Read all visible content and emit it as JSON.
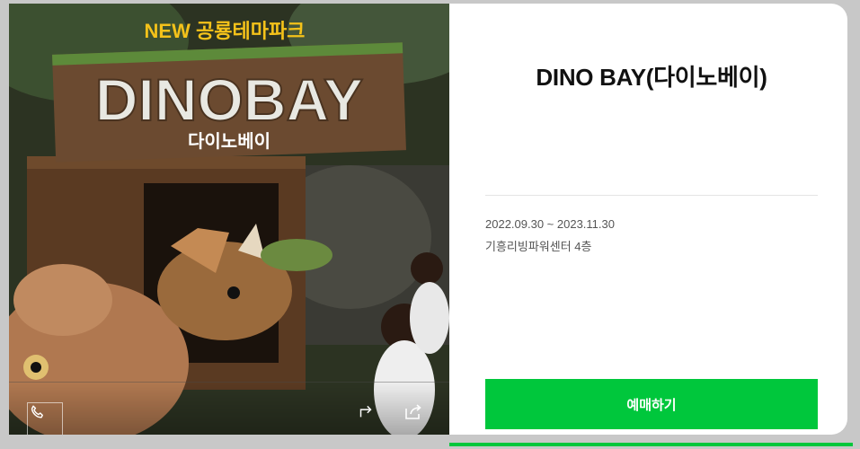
{
  "hero": {
    "sign_top": "NEW 공룡테마파크",
    "sign_main": "DINOBAY",
    "sign_sub": "다이노베이",
    "icons": [
      "phone-icon",
      "share-arrow-icon",
      "share-box-icon"
    ]
  },
  "event": {
    "title": "DINO BAY(다이노베이)",
    "date_range": "2022.09.30 ~ 2023.11.30",
    "venue": "기흥리빙파워센터 4층",
    "book_label": "예매하기"
  },
  "colors": {
    "accent": "#00c73c",
    "background": "#c8c8c8"
  }
}
